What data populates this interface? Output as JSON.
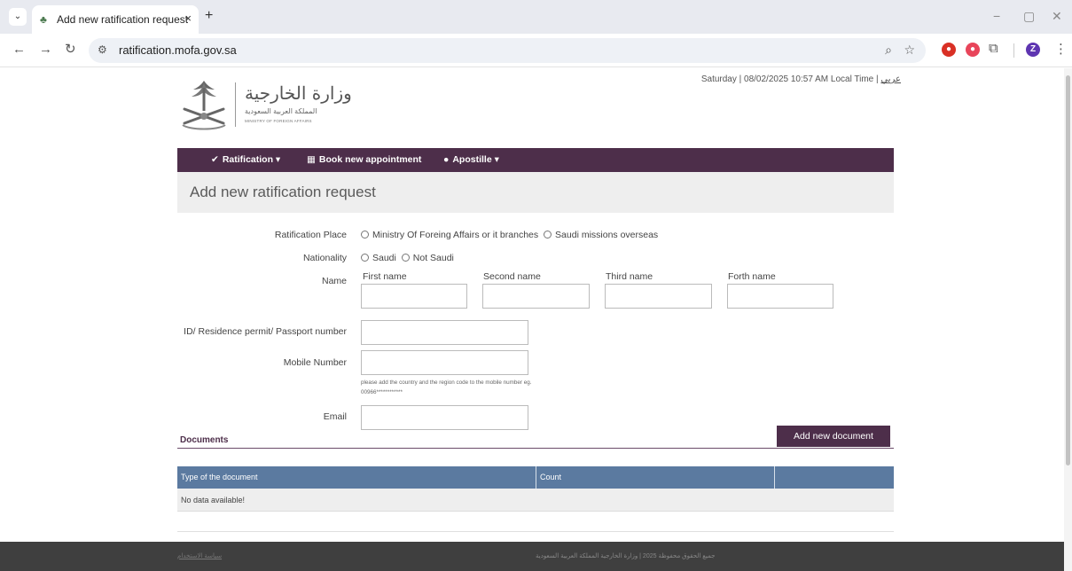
{
  "browser": {
    "tab_title": "Add new ratification request",
    "tab_close": "×",
    "tab_new": "+",
    "url": "ratification.mofa.gov.sa",
    "profile_initial": "Z",
    "win_min": "−",
    "win_restore": "▢",
    "win_close": "✕"
  },
  "header": {
    "logo_ar": "وزارة الخارجية",
    "logo_ar_sub": "المملكة العربية السعودية",
    "logo_en": "MINISTRY OF FOREIGN AFFAIRS",
    "datetime": "Saturday | 08/02/2025 10:57 AM Local Time | ",
    "lang_link": "عربي"
  },
  "nav": {
    "ratification": "Ratification",
    "book": "Book new appointment",
    "apostille": "Apostille"
  },
  "page_title": "Add new ratification request",
  "form": {
    "ratification_place_label": "Ratification Place",
    "place_option_1": "Ministry Of Foreing Affairs or it branches",
    "place_option_2": "Saudi missions overseas",
    "nationality_label": "Nationality",
    "nat_option_1": "Saudi",
    "nat_option_2": "Not Saudi",
    "name_label": "Name",
    "first_name": "First name",
    "second_name": "Second name",
    "third_name": "Third name",
    "forth_name": "Forth name",
    "id_label": "ID/ Residence permit/ Passport number",
    "mobile_label": "Mobile Number",
    "mobile_hint": "please add the country and the region code to the mobile number eg. 00966************",
    "email_label": "Email"
  },
  "documents": {
    "title": "Documents",
    "add_button": "Add new document",
    "columns": [
      "Type of the document",
      "Count"
    ],
    "empty": "No data available!"
  },
  "footer": {
    "link": "سياسة الاستخدام",
    "copyright": "جميع الحقوق محفوظة 2025 | وزارة الخارجية المملكة العربية السعودية"
  },
  "colors": {
    "brand": "#4d2e4a",
    "table_header": "#5b7aa0",
    "footer": "#3f3f3f"
  }
}
